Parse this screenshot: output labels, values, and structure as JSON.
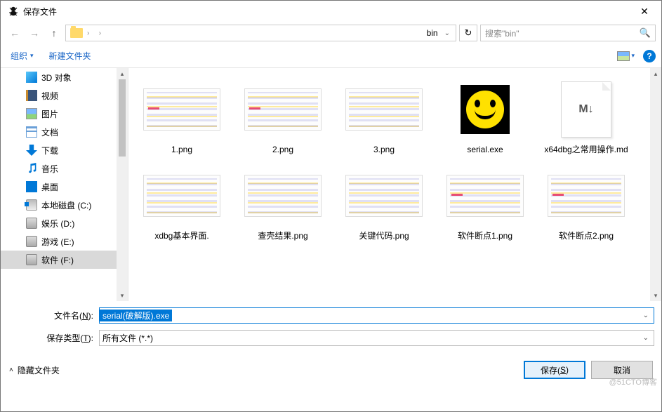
{
  "window": {
    "title": "保存文件"
  },
  "nav": {
    "current_folder_icon": "folder",
    "path_last": "bin",
    "search_placeholder": "搜索\"bin\""
  },
  "toolbar": {
    "organize": "组织",
    "new_folder": "新建文件夹",
    "help": "?"
  },
  "sidebar": {
    "items": [
      {
        "label": "3D 对象",
        "icon": "cube"
      },
      {
        "label": "视频",
        "icon": "film"
      },
      {
        "label": "图片",
        "icon": "pic"
      },
      {
        "label": "文档",
        "icon": "doc"
      },
      {
        "label": "下载",
        "icon": "down"
      },
      {
        "label": "音乐",
        "icon": "music"
      },
      {
        "label": "桌面",
        "icon": "desk"
      },
      {
        "label": "本地磁盘 (C:)",
        "icon": "disk c"
      },
      {
        "label": "娱乐 (D:)",
        "icon": "diskb"
      },
      {
        "label": "游戏 (E:)",
        "icon": "diskb"
      },
      {
        "label": "软件 (F:)",
        "icon": "diskb",
        "selected": true
      }
    ]
  },
  "files": {
    "row1": [
      {
        "name": "1.png",
        "kind": "thumb red"
      },
      {
        "name": "2.png",
        "kind": "thumb red"
      },
      {
        "name": "3.png",
        "kind": "thumb"
      },
      {
        "name": "serial.exe",
        "kind": "smiley"
      },
      {
        "name": "x64dbg之常用操作.md",
        "kind": "md",
        "md_text": "M↓"
      }
    ],
    "row2": [
      {
        "name": "xdbg基本界面.",
        "kind": "thumb"
      },
      {
        "name": "查壳结果.png",
        "kind": "thumb"
      },
      {
        "name": "关键代码.png",
        "kind": "thumb"
      },
      {
        "name": "软件断点1.png",
        "kind": "thumb red"
      },
      {
        "name": "软件断点2.png",
        "kind": "thumb red"
      }
    ]
  },
  "form": {
    "filename_label_pre": "文件名(",
    "filename_label_key": "N",
    "filename_label_post": "):",
    "filename_value": "serial(破解版).exe",
    "filetype_label_pre": "保存类型(",
    "filetype_label_key": "T",
    "filetype_label_post": "):",
    "filetype_value": "所有文件 (*.*)"
  },
  "footer": {
    "hide_folders": "隐藏文件夹",
    "save_pre": "保存(",
    "save_key": "S",
    "save_post": ")",
    "cancel": "取消"
  },
  "watermark": "@51CTO博客"
}
